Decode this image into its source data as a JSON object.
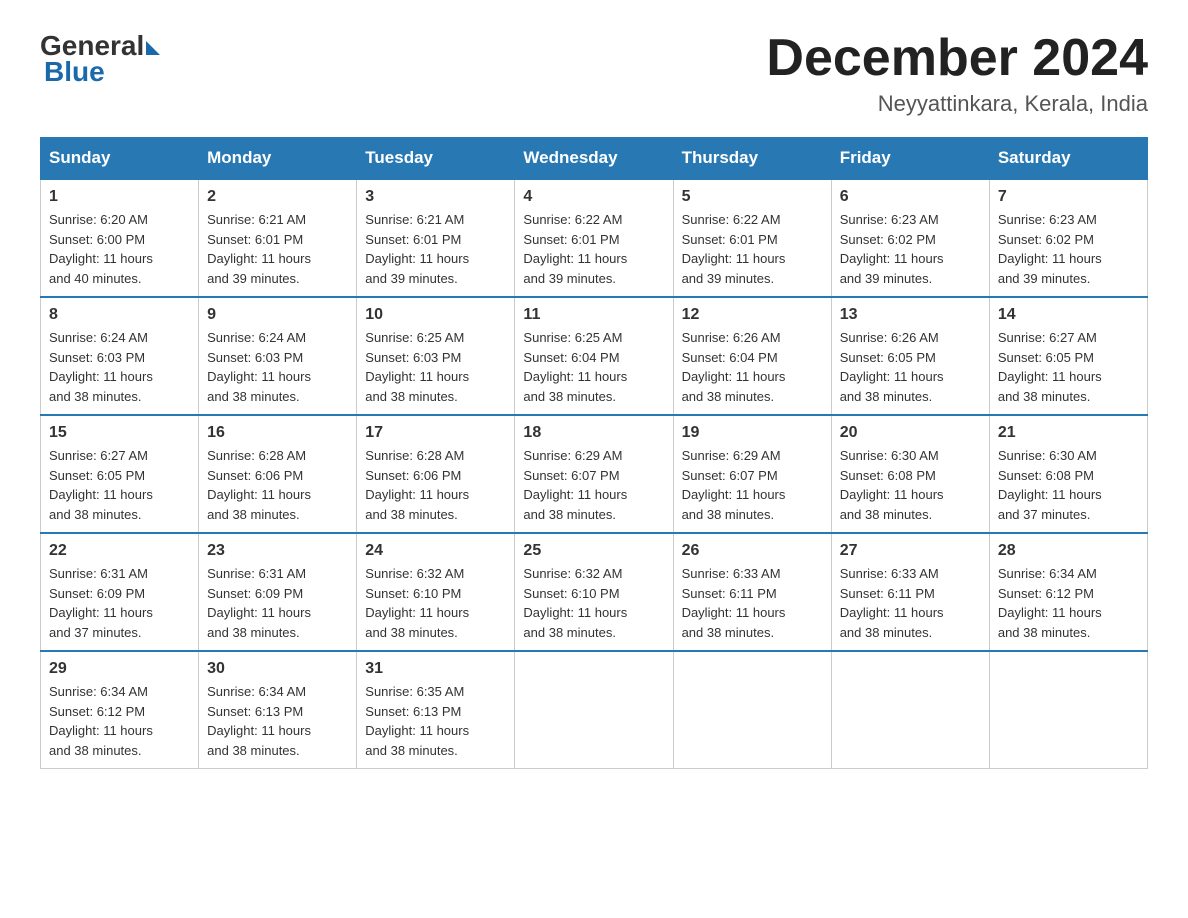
{
  "header": {
    "logo_general": "General",
    "logo_blue": "Blue",
    "title": "December 2024",
    "location": "Neyyattinkara, Kerala, India"
  },
  "days_of_week": [
    "Sunday",
    "Monday",
    "Tuesday",
    "Wednesday",
    "Thursday",
    "Friday",
    "Saturday"
  ],
  "weeks": [
    [
      {
        "day": "1",
        "sunrise": "6:20 AM",
        "sunset": "6:00 PM",
        "daylight": "11 hours and 40 minutes."
      },
      {
        "day": "2",
        "sunrise": "6:21 AM",
        "sunset": "6:01 PM",
        "daylight": "11 hours and 39 minutes."
      },
      {
        "day": "3",
        "sunrise": "6:21 AM",
        "sunset": "6:01 PM",
        "daylight": "11 hours and 39 minutes."
      },
      {
        "day": "4",
        "sunrise": "6:22 AM",
        "sunset": "6:01 PM",
        "daylight": "11 hours and 39 minutes."
      },
      {
        "day": "5",
        "sunrise": "6:22 AM",
        "sunset": "6:01 PM",
        "daylight": "11 hours and 39 minutes."
      },
      {
        "day": "6",
        "sunrise": "6:23 AM",
        "sunset": "6:02 PM",
        "daylight": "11 hours and 39 minutes."
      },
      {
        "day": "7",
        "sunrise": "6:23 AM",
        "sunset": "6:02 PM",
        "daylight": "11 hours and 39 minutes."
      }
    ],
    [
      {
        "day": "8",
        "sunrise": "6:24 AM",
        "sunset": "6:03 PM",
        "daylight": "11 hours and 38 minutes."
      },
      {
        "day": "9",
        "sunrise": "6:24 AM",
        "sunset": "6:03 PM",
        "daylight": "11 hours and 38 minutes."
      },
      {
        "day": "10",
        "sunrise": "6:25 AM",
        "sunset": "6:03 PM",
        "daylight": "11 hours and 38 minutes."
      },
      {
        "day": "11",
        "sunrise": "6:25 AM",
        "sunset": "6:04 PM",
        "daylight": "11 hours and 38 minutes."
      },
      {
        "day": "12",
        "sunrise": "6:26 AM",
        "sunset": "6:04 PM",
        "daylight": "11 hours and 38 minutes."
      },
      {
        "day": "13",
        "sunrise": "6:26 AM",
        "sunset": "6:05 PM",
        "daylight": "11 hours and 38 minutes."
      },
      {
        "day": "14",
        "sunrise": "6:27 AM",
        "sunset": "6:05 PM",
        "daylight": "11 hours and 38 minutes."
      }
    ],
    [
      {
        "day": "15",
        "sunrise": "6:27 AM",
        "sunset": "6:05 PM",
        "daylight": "11 hours and 38 minutes."
      },
      {
        "day": "16",
        "sunrise": "6:28 AM",
        "sunset": "6:06 PM",
        "daylight": "11 hours and 38 minutes."
      },
      {
        "day": "17",
        "sunrise": "6:28 AM",
        "sunset": "6:06 PM",
        "daylight": "11 hours and 38 minutes."
      },
      {
        "day": "18",
        "sunrise": "6:29 AM",
        "sunset": "6:07 PM",
        "daylight": "11 hours and 38 minutes."
      },
      {
        "day": "19",
        "sunrise": "6:29 AM",
        "sunset": "6:07 PM",
        "daylight": "11 hours and 38 minutes."
      },
      {
        "day": "20",
        "sunrise": "6:30 AM",
        "sunset": "6:08 PM",
        "daylight": "11 hours and 38 minutes."
      },
      {
        "day": "21",
        "sunrise": "6:30 AM",
        "sunset": "6:08 PM",
        "daylight": "11 hours and 37 minutes."
      }
    ],
    [
      {
        "day": "22",
        "sunrise": "6:31 AM",
        "sunset": "6:09 PM",
        "daylight": "11 hours and 37 minutes."
      },
      {
        "day": "23",
        "sunrise": "6:31 AM",
        "sunset": "6:09 PM",
        "daylight": "11 hours and 38 minutes."
      },
      {
        "day": "24",
        "sunrise": "6:32 AM",
        "sunset": "6:10 PM",
        "daylight": "11 hours and 38 minutes."
      },
      {
        "day": "25",
        "sunrise": "6:32 AM",
        "sunset": "6:10 PM",
        "daylight": "11 hours and 38 minutes."
      },
      {
        "day": "26",
        "sunrise": "6:33 AM",
        "sunset": "6:11 PM",
        "daylight": "11 hours and 38 minutes."
      },
      {
        "day": "27",
        "sunrise": "6:33 AM",
        "sunset": "6:11 PM",
        "daylight": "11 hours and 38 minutes."
      },
      {
        "day": "28",
        "sunrise": "6:34 AM",
        "sunset": "6:12 PM",
        "daylight": "11 hours and 38 minutes."
      }
    ],
    [
      {
        "day": "29",
        "sunrise": "6:34 AM",
        "sunset": "6:12 PM",
        "daylight": "11 hours and 38 minutes."
      },
      {
        "day": "30",
        "sunrise": "6:34 AM",
        "sunset": "6:13 PM",
        "daylight": "11 hours and 38 minutes."
      },
      {
        "day": "31",
        "sunrise": "6:35 AM",
        "sunset": "6:13 PM",
        "daylight": "11 hours and 38 minutes."
      },
      null,
      null,
      null,
      null
    ]
  ],
  "labels": {
    "sunrise": "Sunrise:",
    "sunset": "Sunset:",
    "daylight": "Daylight:"
  }
}
